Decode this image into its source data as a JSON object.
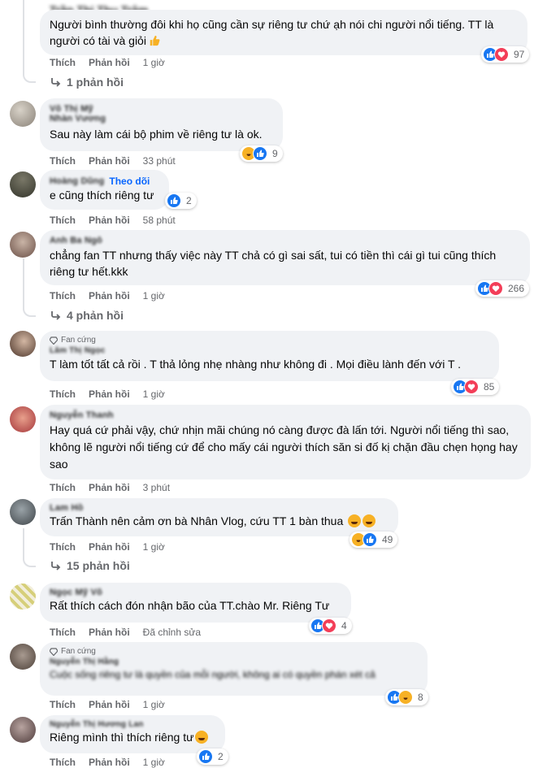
{
  "actions": {
    "like_label": "Thích",
    "reply_label": "Phản hồi"
  },
  "top": {
    "name": "Trần Thị Thu Trâm",
    "text": "Người bình thường đôi khi họ cũng cần sự riêng tư chứ ạh nói chi người nổi tiếng. TT là người có tài và giỏi",
    "time": "1 giờ",
    "reaction_count": "97",
    "replies": "1 phản hồi"
  },
  "comments": [
    {
      "name_line1": "Võ Thị Mỹ",
      "name_line2": "Nhàn Vương",
      "text": "Sau này làm cái bộ phim về riêng tư là ok.",
      "time": "33 phút",
      "reaction_count": "9"
    },
    {
      "name": "Hoàng Dũng",
      "follow": "Theo dõi",
      "text": "e cũng thích riêng tư",
      "time": "58 phút",
      "reaction_count": "2"
    },
    {
      "name": "Anh Ba Ngô",
      "text": "chẳng fan TT nhưng thấy việc này TT chả có gì sai sất, tui có tiền thì cái gì tui cũng thích riêng tư hết.kkk",
      "time": "1 giờ",
      "reaction_count": "266",
      "replies": "4 phản hồi"
    },
    {
      "badge": "Fan cứng",
      "name": "Lâm Thị Ngọc",
      "text": "T làm tốt tất cả rồi . T thả lỏng nhẹ nhàng như không đi . Mọi điều lành đến với T .",
      "time": "1 giờ",
      "reaction_count": "85"
    },
    {
      "name": "Nguyễn Thanh",
      "text": "Hay quá cứ phải vậy, chứ nhịn mãi chúng nó càng được đà lấn tới. Người nổi tiếng thì sao, không lẽ người nổi tiếng cứ để cho mấy cái người thích săn si đố kị chặn đầu chẹn họng hay sao",
      "time": "3 phút"
    },
    {
      "name": "Lam Hồ",
      "text": "Trấn Thành nên cảm ơn bà Nhân Vlog, cứu TT 1 bàn thua",
      "time": "1 giờ",
      "reaction_count": "49",
      "replies": "15 phản hồi"
    },
    {
      "name": "Ngọc Mỹ Võ",
      "text": "Rất thích cách đón nhận bão của TT.chào Mr. Riêng Tư",
      "time": "Đã chỉnh sửa",
      "reaction_count": "4"
    },
    {
      "badge": "Fan cứng",
      "name": "Nguyễn Thị Hằng",
      "text": "Cuộc sống riêng tư là quyền của mỗi người, không ai có quyền phán xét cả",
      "time": "1 giờ",
      "reaction_count": "8"
    },
    {
      "name": "Nguyễn Thị Hương Lan",
      "text": "Riêng mình thì thích riêng tư",
      "time": "1 giờ",
      "reaction_count": "2"
    }
  ],
  "colors": {
    "bubble": "#f0f2f5",
    "meta": "#65676b",
    "accent": "#0866ff",
    "like": "#1877f2",
    "love": "#f33e58",
    "haha": "#f7b125"
  }
}
